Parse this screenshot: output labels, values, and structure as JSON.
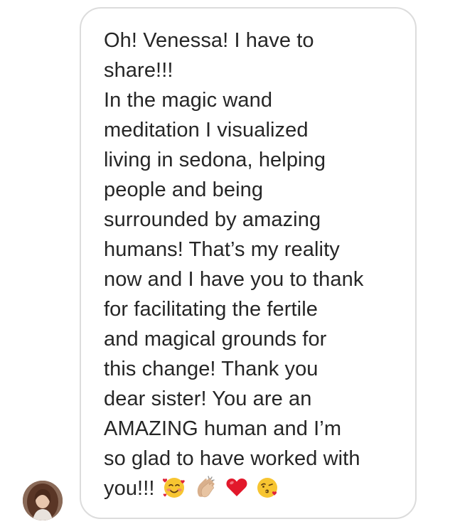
{
  "message": {
    "lines": [
      "Oh! Venessa! I have to",
      "share!!!",
      "In the magic wand",
      "meditation I visualized",
      "living in sedona, helping",
      "people and being",
      "surrounded by amazing",
      "humans! That’s my reality",
      "now and I have you to thank",
      "for facilitating the fertile",
      "and magical grounds for",
      "this change! Thank you",
      "dear sister! You are an",
      "AMAZING human and I’m",
      "so glad to have worked with",
      "you!!!"
    ],
    "emojis": [
      "smiling-face-with-hearts-icon",
      "clapping-hands-icon",
      "red-heart-icon",
      "face-blowing-kiss-icon"
    ]
  },
  "sender": {
    "avatar": "avatar"
  }
}
